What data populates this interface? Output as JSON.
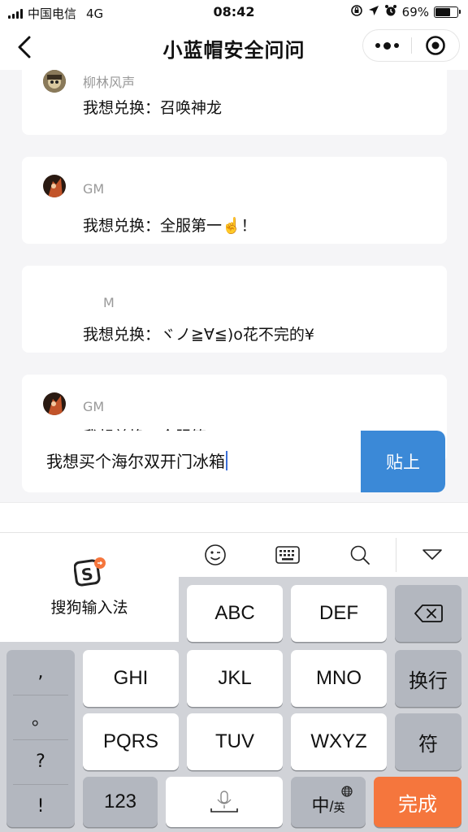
{
  "status_bar": {
    "carrier": "中国电信",
    "network": "4G",
    "time": "08:42",
    "battery_percent": "69%",
    "battery_level": 0.69
  },
  "nav": {
    "title": "小蓝帽安全问问"
  },
  "messages": [
    {
      "user": "柳林风声",
      "text": "我想兑换：召唤神龙"
    },
    {
      "user": "GM",
      "text": "我想兑换：全服第一☝️！"
    },
    {
      "user": "M",
      "text": "我想兑换：ヾノ≧∀≦)o花不完的¥"
    },
    {
      "user": "GM",
      "text": "我想兑换：全服第"
    }
  ],
  "input": {
    "value": "我想买个海尔双开门冰箱",
    "paste_label": "贴上"
  },
  "keyboard": {
    "ime_name": "搜狗输入法",
    "keys": {
      "abc": "ABC",
      "def": "DEF",
      "ghi": "GHI",
      "jkl": "JKL",
      "mno": "MNO",
      "pqrs": "PQRS",
      "tuv": "TUV",
      "wxyz": "WXYZ",
      "newline": "换行",
      "symbols": "符",
      "numbers": "123",
      "lang_main": "中",
      "lang_sub": "英",
      "done": "完成"
    },
    "punctuation": [
      ",",
      "。",
      "?",
      "!"
    ],
    "accent_color": "#f5763d"
  }
}
